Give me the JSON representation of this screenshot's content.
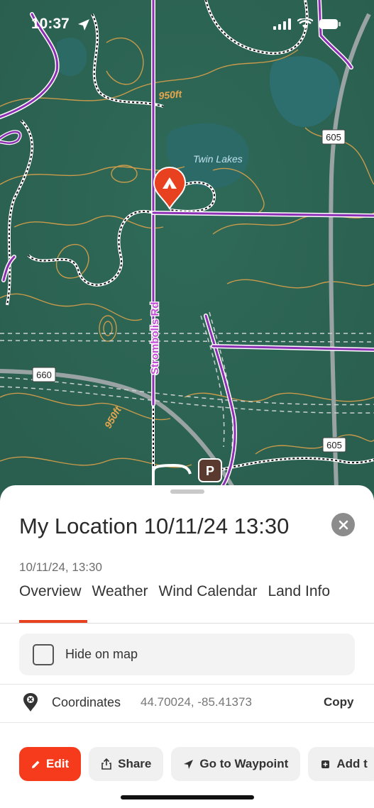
{
  "status": {
    "time": "10:37"
  },
  "map": {
    "labels": {
      "elevation_top": "950ft",
      "elevation_bottom": "950ft",
      "lake": "Twin Lakes",
      "road": "Strombolis Rd",
      "route_top": "605",
      "route_right": "605",
      "route_left": "660",
      "parking": "P"
    },
    "colors": {
      "contour": "#d9a04a",
      "trail": "#8c2fb4",
      "marker": "#e8411f"
    }
  },
  "sheet": {
    "title": "My Location 10/11/24 13:30",
    "subtitle": "10/11/24, 13:30",
    "tabs": [
      "Overview",
      "Weather",
      "Wind Calendar",
      "Land Info"
    ],
    "hide_on_map_label": "Hide on map",
    "coordinates_label": "Coordinates",
    "coordinates_value": "44.70024, -85.41373",
    "copy_label": "Copy",
    "actions": {
      "edit": "Edit",
      "share": "Share",
      "go_to_waypoint": "Go to Waypoint",
      "add": "Add t"
    }
  }
}
